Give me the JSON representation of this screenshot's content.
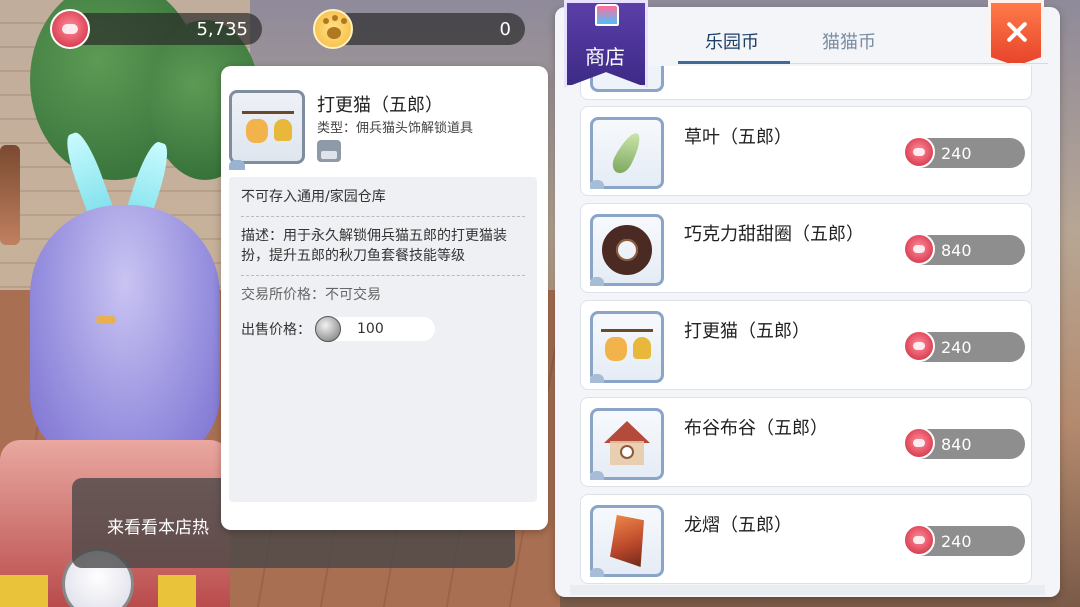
{
  "currencies": {
    "park_coin": {
      "icon": "park-coin-icon",
      "value": "5,735"
    },
    "cat_coin": {
      "icon": "cat-paw-coin-icon",
      "value": "0"
    }
  },
  "chat": {
    "text": "来看看本店热"
  },
  "detail": {
    "name": "打更猫（五郎）",
    "type_line": "类型：佣兵猫头饰解锁道具",
    "storage_note": "不可存入通用/家园仓库",
    "description": "描述：用于永久解锁佣兵猫五郎的打更猫装扮，提升五郎的秋刀鱼套餐技能等级",
    "trade_price": "交易所价格：不可交易",
    "sell_label": "出售价格：",
    "sell_value": "100",
    "sell_icon": "silver-coin-icon"
  },
  "shop": {
    "title": "商店",
    "tabs": [
      {
        "label": "乐园币",
        "active": true
      },
      {
        "label": "猫猫币",
        "active": false
      }
    ],
    "items": [
      {
        "name": "草叶（五郎）",
        "price": "240",
        "icon": "leaf-icon"
      },
      {
        "name": "巧克力甜甜圈（五郎）",
        "price": "840",
        "icon": "donut-icon"
      },
      {
        "name": "打更猫（五郎）",
        "price": "240",
        "icon": "cat-bell-icon"
      },
      {
        "name": "布谷布谷（五郎）",
        "price": "840",
        "icon": "cuckoo-house-icon"
      },
      {
        "name": "龙熠（五郎）",
        "price": "240",
        "icon": "dragon-claw-icon"
      }
    ]
  },
  "colors": {
    "accent_blue": "#3e6a9a",
    "coin_pink": "#e24d60",
    "price_pill": "#8e8e8e",
    "close_orange": "#e8452b",
    "banner_purple": "#5b3fa8"
  }
}
